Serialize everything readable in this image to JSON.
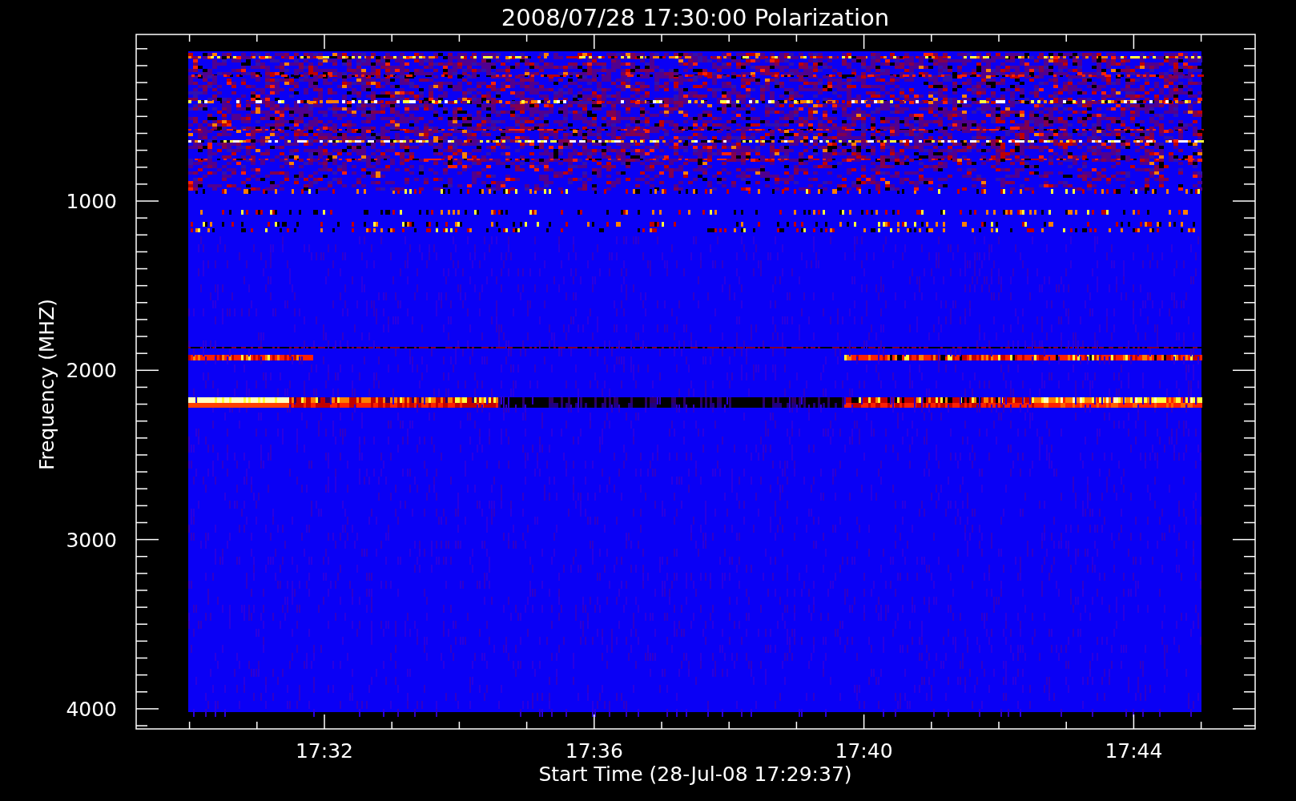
{
  "title": "2008/07/28 17:30:00 Polarization",
  "y_axis": {
    "label": "Frequency (MHZ)",
    "tick_labels": [
      "1000",
      "2000",
      "3000",
      "4000"
    ]
  },
  "x_axis": {
    "label": "Start Time (28-Jul-08 17:29:37)",
    "tick_labels": [
      "17:32",
      "17:36",
      "17:40",
      "17:44"
    ]
  }
}
